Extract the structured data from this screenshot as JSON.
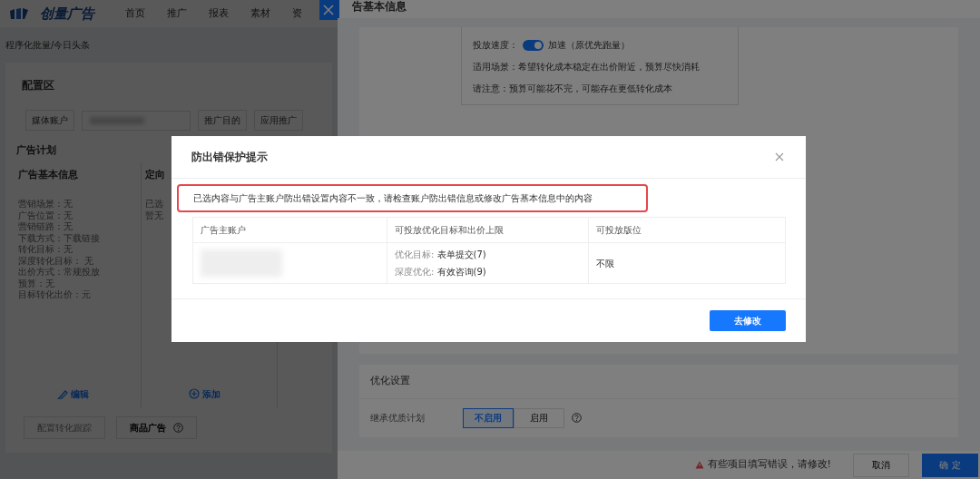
{
  "app": {
    "logo": "创量广告",
    "nav": [
      {
        "label": "首页"
      },
      {
        "label": "推广"
      },
      {
        "label": "报表"
      },
      {
        "label": "素材"
      },
      {
        "label": "资"
      }
    ]
  },
  "breadcrumb": "程序化批量/今日头条",
  "config": {
    "title": "配置区",
    "account_label": "媒体账户",
    "purpose_label": "推广目的",
    "purpose_value": "应用推广"
  },
  "plan": {
    "title": "广告计划",
    "columns": [
      {
        "title": "广告基本信息",
        "lines": [
          "营销场景：无",
          "广告位置：无",
          "营销链路：无",
          "下载方式：下载链接",
          "转化目标：无",
          "深度转化目标：  无",
          "出价方式：常规投放",
          "预算：无",
          "目标转化出价：元"
        ],
        "action": "编辑",
        "kind": "edit"
      },
      {
        "title": "定向",
        "lines": [
          "已选",
          "暂无"
        ],
        "action": "添加",
        "kind": "add"
      }
    ]
  },
  "bottom_buttons": [
    {
      "label": "配置转化跟踪",
      "disabled": true,
      "help": false
    },
    {
      "label": "商品广告",
      "disabled": false,
      "help": true
    }
  ],
  "drawer": {
    "title": "告基本信息",
    "speed": {
      "label": "投放速度：",
      "on": true,
      "text": "加速（原优先跑量）"
    },
    "notes": [
      "适用场景：希望转化成本稳定在出价附近，预算尽快消耗",
      "请注意：预算可能花不完，可能存在更低转化成本"
    ],
    "optimization": {
      "title": "优化设置",
      "field": "继承优质计划",
      "options": [
        {
          "label": "不启用",
          "selected": true
        },
        {
          "label": "启用",
          "selected": false
        }
      ]
    },
    "footer": {
      "error": "有些项目填写错误，请修改!",
      "cancel": "取消",
      "ok": "确 定"
    }
  },
  "dialog": {
    "title": "防出错保护提示",
    "alert": "已选内容与广告主账户防出错设置内容不一致，请检查账户防出错信息或修改广告基本信息中的内容",
    "columns": [
      "广告主账户",
      "可投放优化目标和出价上限",
      "可投放版位"
    ],
    "rows": [
      {
        "targets": [
          {
            "label": "优化目标:",
            "value": "表单提交(7)"
          },
          {
            "label": "深度优化:",
            "value": "有效咨询(9)"
          }
        ],
        "placement": "不限"
      }
    ],
    "button": "去修改"
  }
}
